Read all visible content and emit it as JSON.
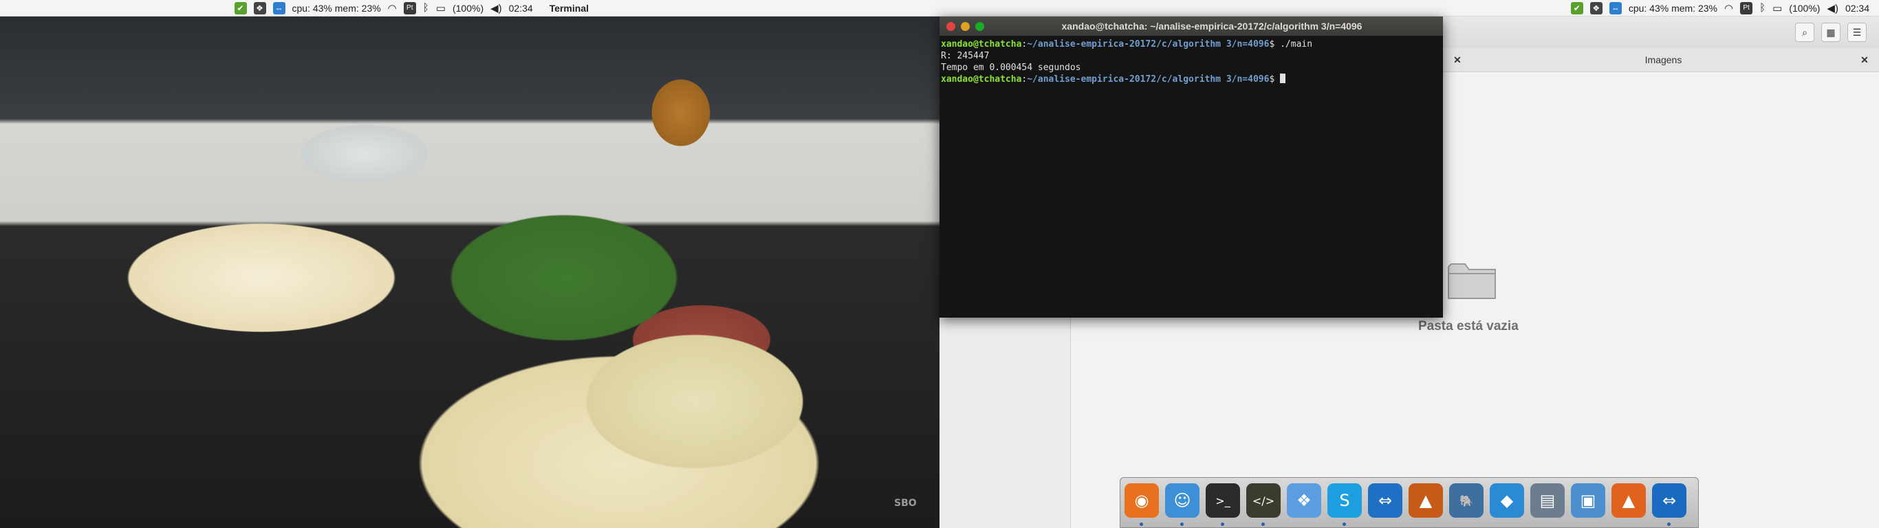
{
  "top_panel": {
    "cpu_mem": "cpu: 43% mem: 23%",
    "keyboard_layout": "Pt",
    "battery": "(100%)",
    "clock": "02:34",
    "active_app": "Terminal"
  },
  "terminal": {
    "title": "xandao@tchatcha: ~/analise-empirica-20172/c/algorithm 3/n=4096",
    "prompt_userhost": "xandao@tchatcha",
    "prompt_path": "~/analise-empirica-20172/c/algorithm 3/n=4096",
    "prompt_symbol": "$",
    "command": " ./main",
    "output_line1": "R: 245447",
    "output_line2": "Tempo em 0.000454 segundos"
  },
  "file_manager": {
    "tab_label": "Imagens",
    "empty_message": "Pasta está vazia"
  },
  "photo": {
    "watermark": "SBO"
  },
  "dock": {
    "items": [
      {
        "name": "firefox-icon",
        "glyph": "◉",
        "color": "#e8701f",
        "running": true
      },
      {
        "name": "finder-icon",
        "glyph": "☺",
        "color": "#3d8fd6",
        "running": true
      },
      {
        "name": "terminal-icon",
        "glyph": ">_",
        "color": "#2b2b2b",
        "running": true
      },
      {
        "name": "code-editor-icon",
        "glyph": "</>",
        "color": "#3b3b2e",
        "running": true
      },
      {
        "name": "dropbox-icon",
        "glyph": "❖",
        "color": "#5a9de0",
        "running": false
      },
      {
        "name": "skype-icon",
        "glyph": "S",
        "color": "#1ea0e0",
        "running": true
      },
      {
        "name": "teamviewer-icon",
        "glyph": "⇔",
        "color": "#1f6fc4",
        "running": false
      },
      {
        "name": "matlab-icon",
        "glyph": "▲",
        "color": "#c85a18",
        "running": false
      },
      {
        "name": "postgresql-icon",
        "glyph": "🐘",
        "color": "#3f6f9f",
        "running": false
      },
      {
        "name": "mysql-workbench-icon",
        "glyph": "◆",
        "color": "#2a8ad4",
        "running": false
      },
      {
        "name": "scanner-icon",
        "glyph": "▤",
        "color": "#6b7d8f",
        "running": false
      },
      {
        "name": "virtualbox-icon",
        "glyph": "▣",
        "color": "#4d8fce",
        "running": false
      },
      {
        "name": "ubuntu-software-icon",
        "glyph": "▲",
        "color": "#e0621e",
        "running": false
      },
      {
        "name": "teamviewer-2-icon",
        "glyph": "⇔",
        "color": "#1a6bbf",
        "running": true
      }
    ]
  }
}
